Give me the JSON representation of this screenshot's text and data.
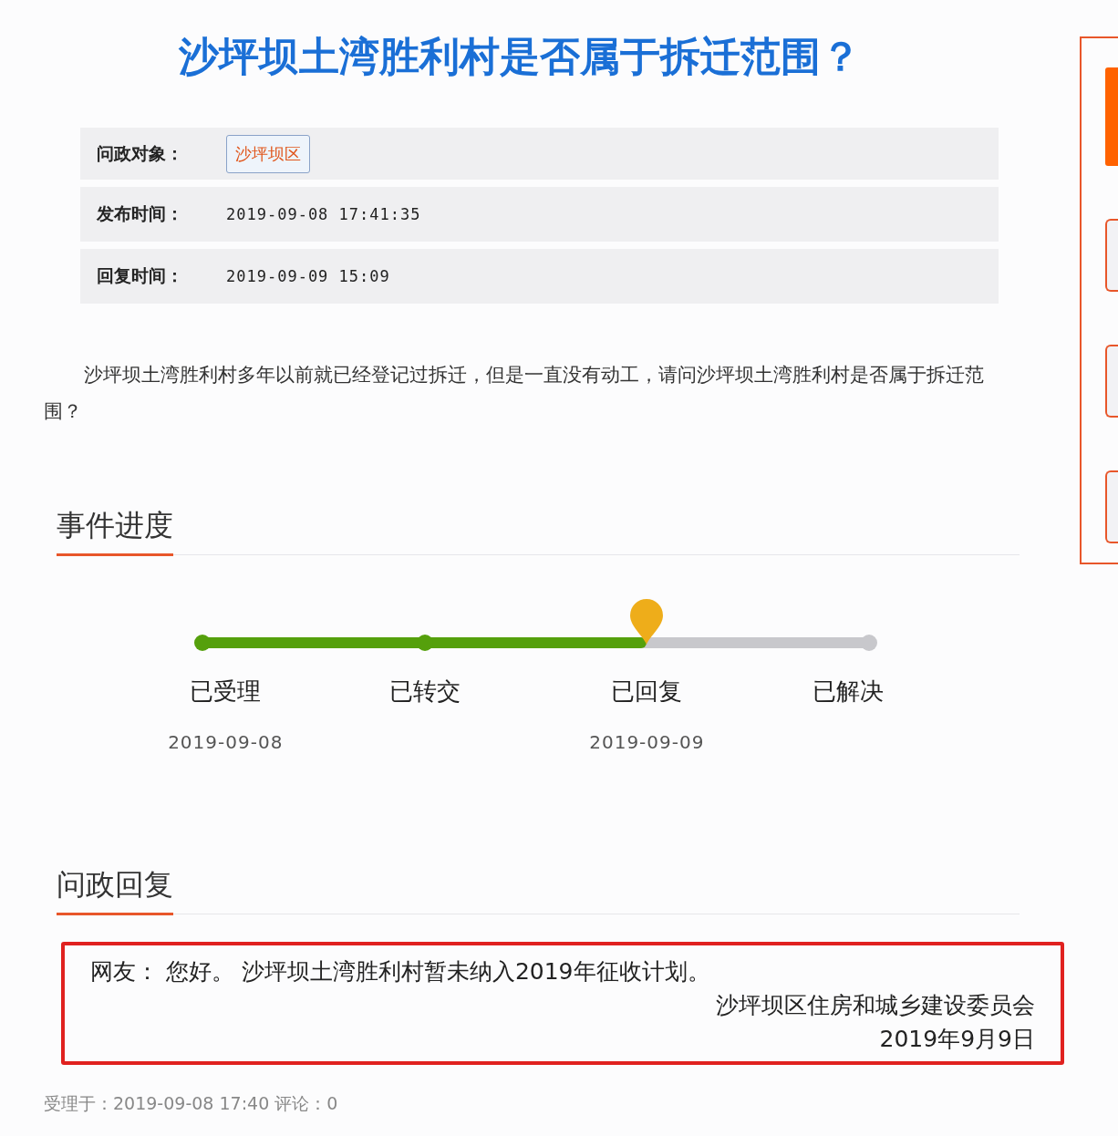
{
  "title": "沙坪坝土湾胜利村是否属于拆迁范围？",
  "info_rows": [
    {
      "label": "问政对象：",
      "kind": "tag",
      "value": "沙坪坝区"
    },
    {
      "label": "发布时间：",
      "kind": "text",
      "value": "2019-09-08 17:41:35"
    },
    {
      "label": "回复时间：",
      "kind": "text",
      "value": "2019-09-09 15:09"
    }
  ],
  "question": "沙坪坝土湾胜利村多年以前就已经登记过拆迁，但是一直没有动工，请问沙坪坝土湾胜利村是否属于拆迁范围？",
  "progress": {
    "heading": "事件进度",
    "steps": [
      {
        "label": "已受理",
        "kind": "done",
        "date": "2019-09-08"
      },
      {
        "label": "已转交",
        "kind": "done"
      },
      {
        "label": "已回复",
        "kind": "current",
        "date": "2019-09-09"
      },
      {
        "label": "已解决",
        "kind": "pending"
      }
    ]
  },
  "reply": {
    "heading": "问政回复",
    "lines": [
      {
        "text": "网友： 您好。 沙坪坝土湾胜利村暂未纳入2019年征收计划。",
        "kind": "message"
      },
      {
        "text": "沙坪坝区住房和城乡建设委员会",
        "kind": "signature"
      },
      {
        "text": "2019年9月9日",
        "kind": "signature"
      }
    ]
  },
  "footer": "受理于：2019-09-08 17:40 评论：0"
}
